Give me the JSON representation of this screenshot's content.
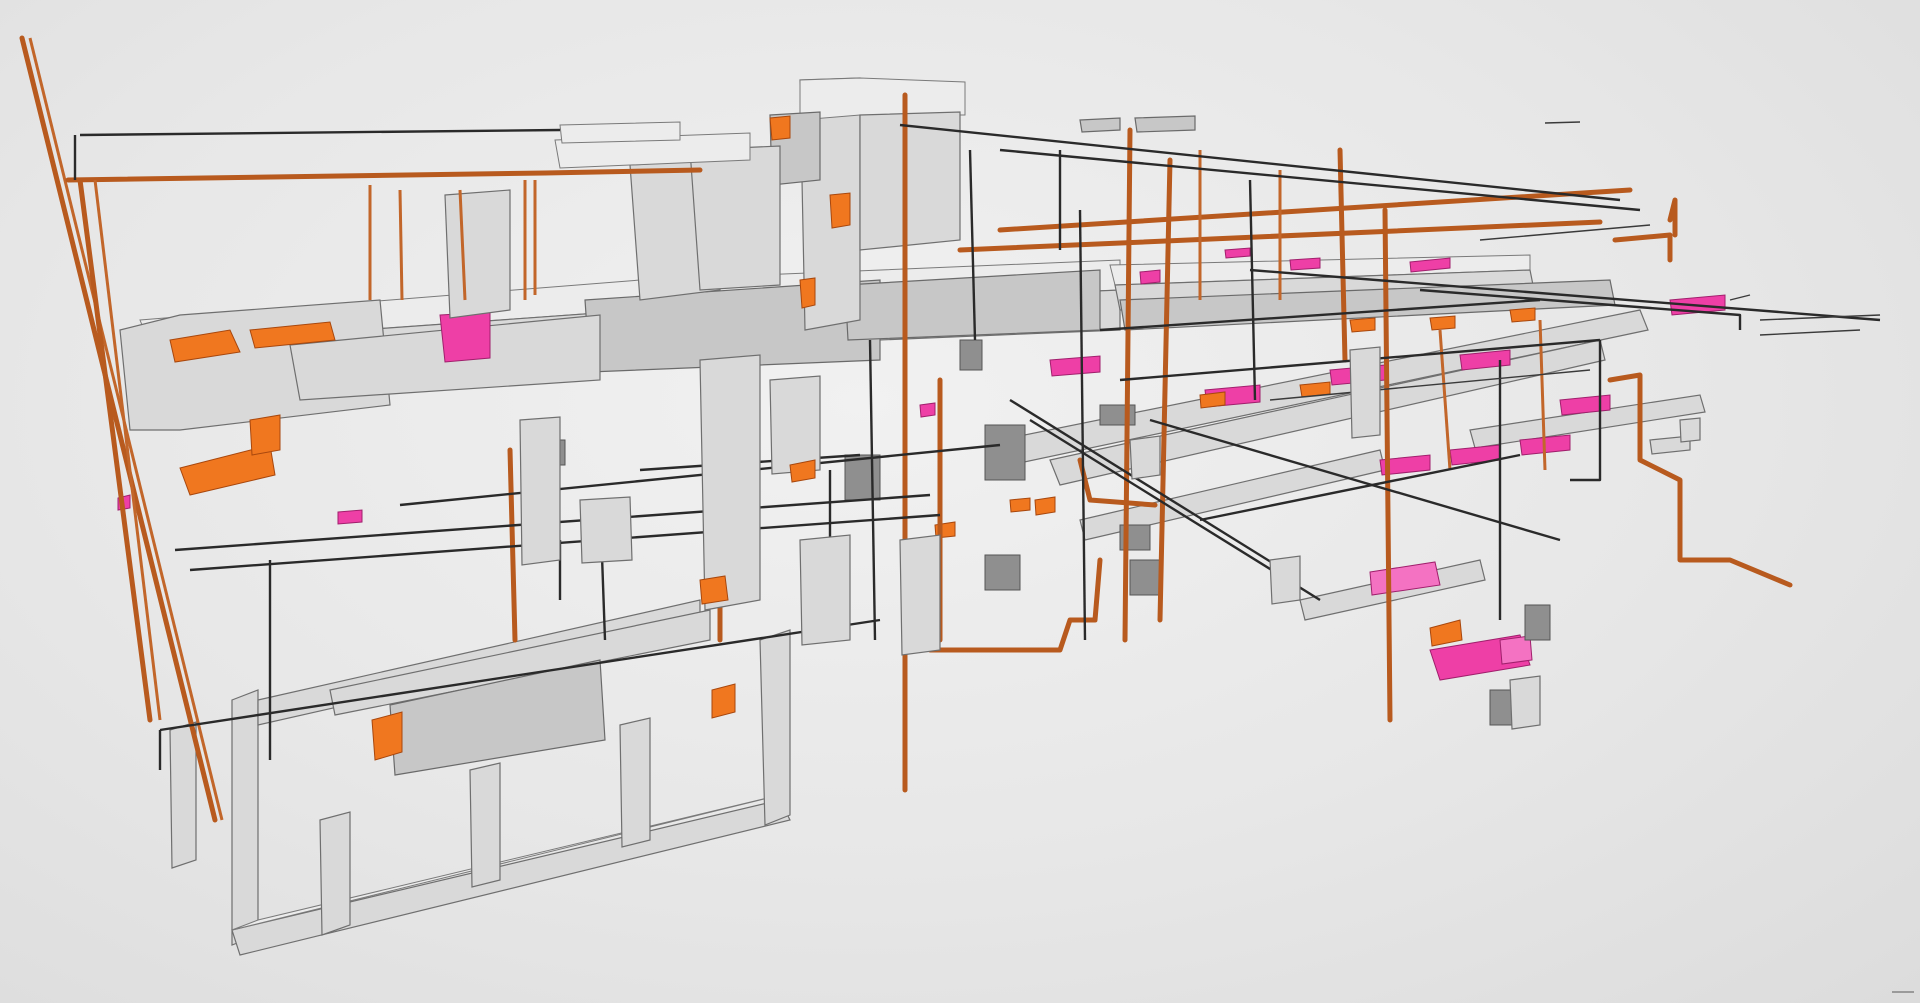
{
  "view": {
    "background_color": "#e7e7e7",
    "colors": {
      "duct": "#d9d9d9",
      "pipe": "#b85a1e",
      "conduit": "#2a2a2a",
      "accent_orange": "#f0771f",
      "equipment_magenta": "#ee3fa6"
    },
    "icons": {
      "corner_indicator": "nav-corner-icon"
    }
  }
}
